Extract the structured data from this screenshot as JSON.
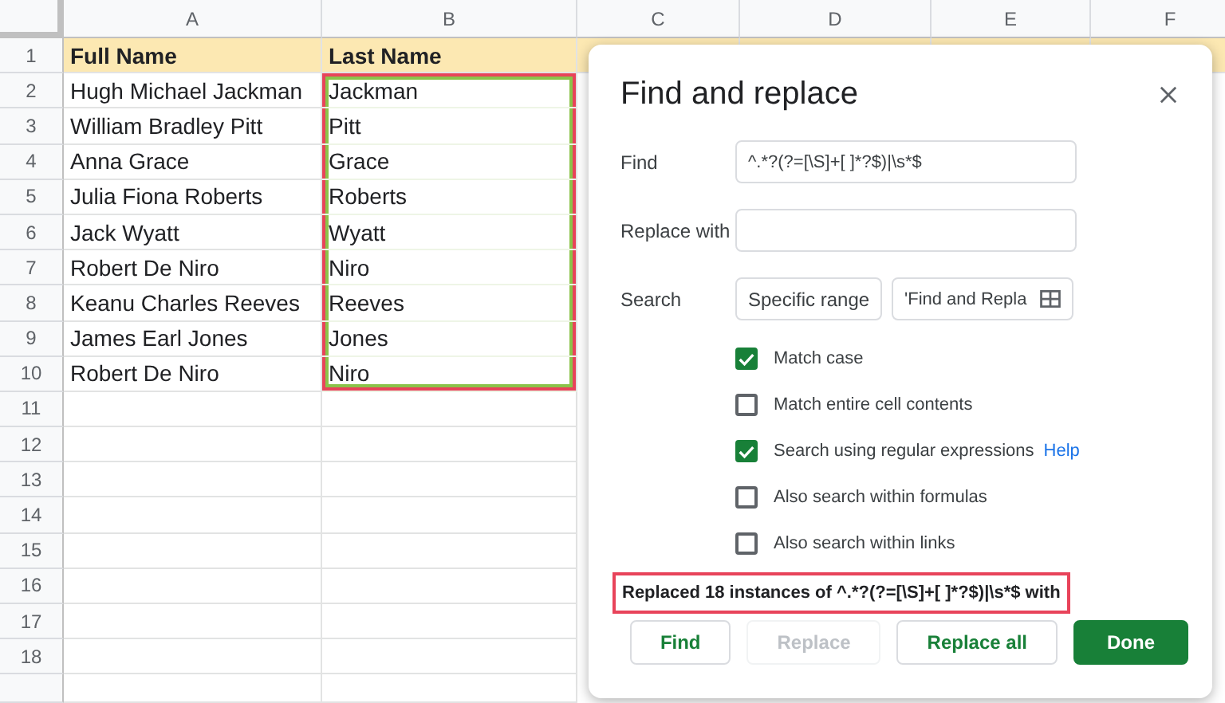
{
  "sheet": {
    "columns": [
      "A",
      "B",
      "C",
      "D",
      "E",
      "F"
    ],
    "rows": [
      {
        "number": "1",
        "kind": "header",
        "selected": false,
        "cells": [
          "Full Name",
          "Last Name"
        ]
      },
      {
        "number": "2",
        "kind": "data",
        "selected": true,
        "cells": [
          "Hugh Michael Jackman",
          "Jackman"
        ]
      },
      {
        "number": "3",
        "kind": "data",
        "selected": true,
        "cells": [
          "William Bradley Pitt",
          "Pitt"
        ]
      },
      {
        "number": "4",
        "kind": "data",
        "selected": true,
        "cells": [
          "Anna Grace",
          "Grace"
        ]
      },
      {
        "number": "5",
        "kind": "data",
        "selected": true,
        "cells": [
          "Julia Fiona Roberts",
          "Roberts"
        ]
      },
      {
        "number": "6",
        "kind": "data",
        "selected": true,
        "cells": [
          "Jack Wyatt",
          "Wyatt"
        ]
      },
      {
        "number": "7",
        "kind": "data",
        "selected": true,
        "cells": [
          "Robert De Niro",
          "Niro"
        ]
      },
      {
        "number": "8",
        "kind": "data",
        "selected": true,
        "cells": [
          "Keanu Charles Reeves",
          "Reeves"
        ]
      },
      {
        "number": "9",
        "kind": "data",
        "selected": true,
        "cells": [
          "James Earl Jones",
          "Jones"
        ]
      },
      {
        "number": "10",
        "kind": "data",
        "selected": true,
        "cells": [
          "Robert De Niro",
          "Niro"
        ]
      },
      {
        "number": "11",
        "kind": "data",
        "selected": false
      },
      {
        "number": "12",
        "kind": "data",
        "selected": false
      },
      {
        "number": "13",
        "kind": "data",
        "selected": false
      },
      {
        "number": "14",
        "kind": "data",
        "selected": false
      },
      {
        "number": "15",
        "kind": "data",
        "selected": false
      },
      {
        "number": "16",
        "kind": "data",
        "selected": false
      },
      {
        "number": "17",
        "kind": "data",
        "selected": false
      },
      {
        "number": "18",
        "kind": "data",
        "selected": false
      }
    ]
  },
  "dialog": {
    "title": "Find and replace",
    "find": {
      "label": "Find",
      "value": "^.*?(?=[\\S]+[ ]*?$)|\\s*$"
    },
    "replace": {
      "label": "Replace with"
    },
    "search": {
      "label": "Search",
      "dropdown": "Specific range",
      "range": "'Find and Repla"
    },
    "options": [
      {
        "label": "Match case",
        "checked": true
      },
      {
        "label": "Match entire cell contents",
        "checked": false
      },
      {
        "label": "Search using regular expressions",
        "checked": true,
        "link": "Help"
      },
      {
        "label": "Also search within formulas",
        "checked": false
      },
      {
        "label": "Also search within links",
        "checked": false
      }
    ],
    "status": {
      "text": "Replaced 18 instances of ^.*?(?=[\\S]+[ ]*?$)|\\s*$ with",
      "highlighted": true
    },
    "buttons": [
      {
        "label": "Find",
        "kind": "outline",
        "disabled": false
      },
      {
        "label": "Replace",
        "kind": "outline",
        "disabled": true
      },
      {
        "label": "Replace all",
        "kind": "outline",
        "disabled": false
      },
      {
        "label": "Done",
        "kind": "primary",
        "disabled": false
      }
    ]
  }
}
